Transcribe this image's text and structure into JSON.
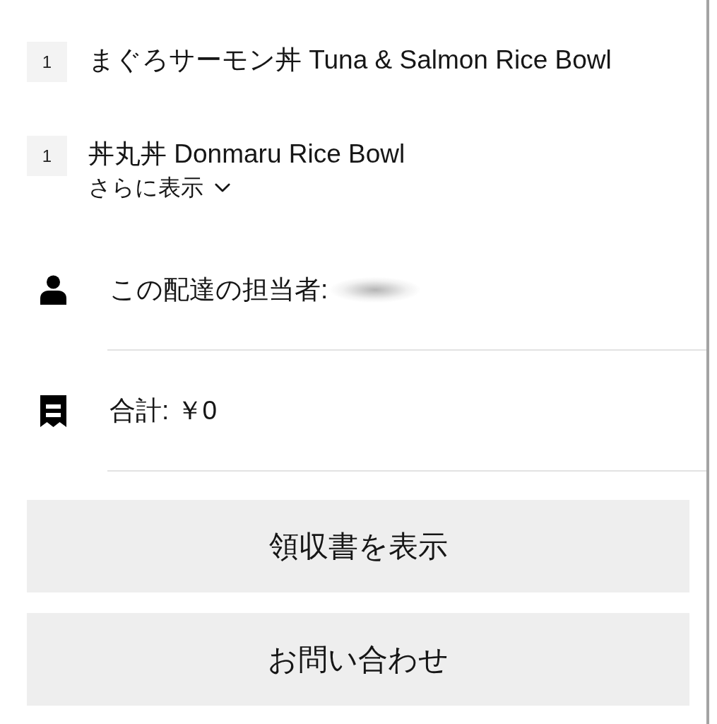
{
  "items": [
    {
      "quantity": "1",
      "name": "まぐろサーモン丼 Tuna & Salmon Rice Bowl"
    },
    {
      "quantity": "1",
      "name": "丼丸丼 Donmaru Rice Bowl",
      "show_more": {
        "label": "さらに表示",
        "expanded": false
      }
    }
  ],
  "details": [
    {
      "kind": "courier",
      "label": "この配達の担当者:",
      "name_redacted": true
    },
    {
      "kind": "total",
      "label": "合計: ￥0"
    }
  ],
  "buttons": [
    "領収書を表示",
    "お問い合わせ"
  ]
}
